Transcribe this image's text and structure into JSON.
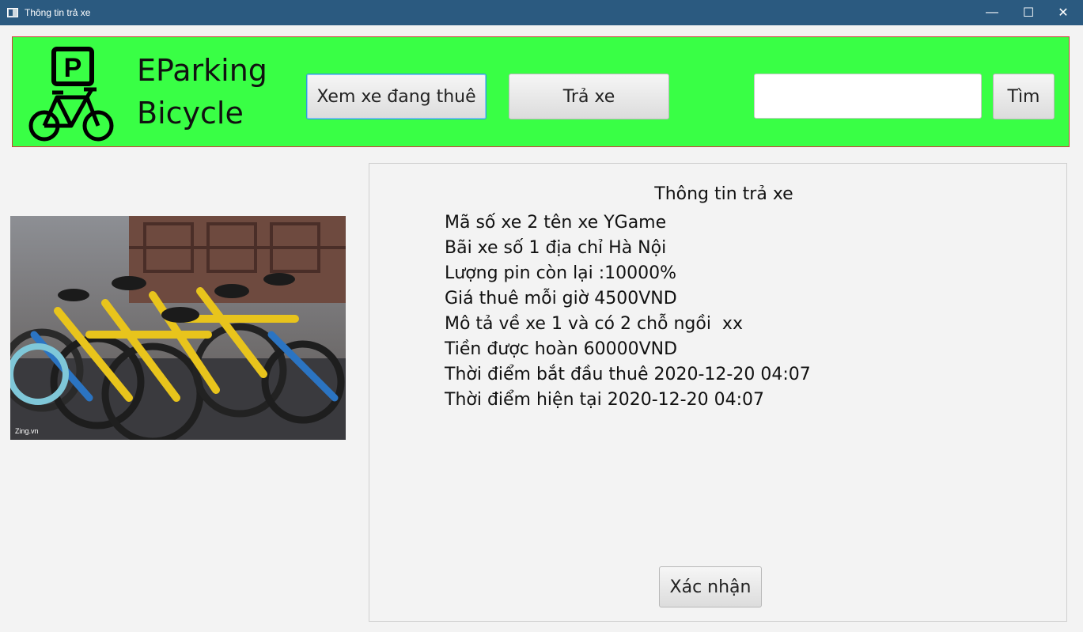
{
  "window": {
    "title": "Thông tin trả xe",
    "minimize_glyph": "—",
    "maximize_glyph": "☐",
    "close_glyph": "✕"
  },
  "header": {
    "brand_line1": "EParking",
    "brand_line2": "Bicycle",
    "rented_button": "Xem xe đang thuê",
    "return_button": "Trả xe",
    "search_value": "",
    "search_button": "Tìm",
    "logo_letter": "P"
  },
  "panel": {
    "title": "Thông tin trả xe",
    "lines": [
      "Mã số xe 2 tên xe YGame",
      "Bãi xe số 1 địa chỉ Hà Nội",
      "Lượng pin còn lại :10000%",
      "Giá thuê mỗi giờ 4500VND",
      "Mô tả về xe 1 và có 2 chỗ ngồi  xx",
      "Tiền được hoàn 60000VND",
      "Thời điểm bắt đầu thuê 2020-12-20 04:07",
      "Thời điểm hiện tại 2020-12-20 04:07"
    ],
    "confirm_button": "Xác nhận"
  },
  "photo": {
    "watermark": "Zing.vn"
  },
  "colors": {
    "titlebar": "#2b5a80",
    "header_bg": "#39ff45",
    "header_border": "#d03b3b",
    "focus": "#2f9ae0"
  },
  "icons": {
    "logo": "parking-bicycle-icon",
    "app": "window-app-icon"
  }
}
